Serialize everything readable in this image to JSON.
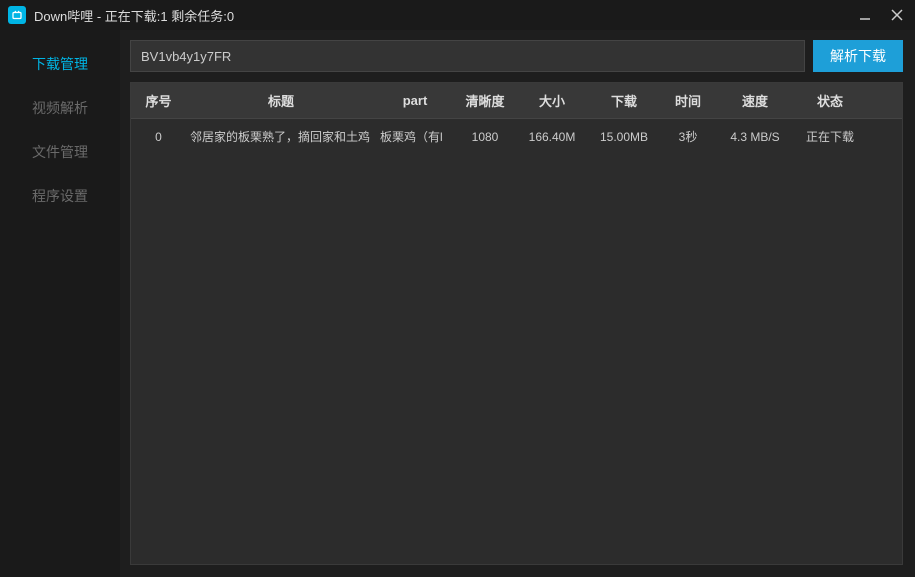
{
  "titlebar": {
    "title": "Down哔哩 - 正在下载:1  剩余任务:0"
  },
  "sidebar": {
    "items": [
      {
        "label": "下载管理",
        "active": true
      },
      {
        "label": "视频解析",
        "active": false
      },
      {
        "label": "文件管理",
        "active": false
      },
      {
        "label": "程序设置",
        "active": false
      }
    ]
  },
  "input": {
    "value": "BV1vb4y1y7FR",
    "button": "解析下载"
  },
  "table": {
    "headers": {
      "seq": "序号",
      "title": "标题",
      "part": "part",
      "quality": "清晰度",
      "size": "大小",
      "download": "下载",
      "time": "时间",
      "speed": "速度",
      "status": "状态"
    },
    "rows": [
      {
        "seq": "0",
        "title": "邻居家的板栗熟了，摘回家和土鸡",
        "part": "板栗鸡（有l",
        "quality": "1080",
        "size": "166.40M",
        "download": "15.00MB",
        "time": "3秒",
        "speed": "4.3 MB/S",
        "status": "正在下载"
      }
    ]
  }
}
